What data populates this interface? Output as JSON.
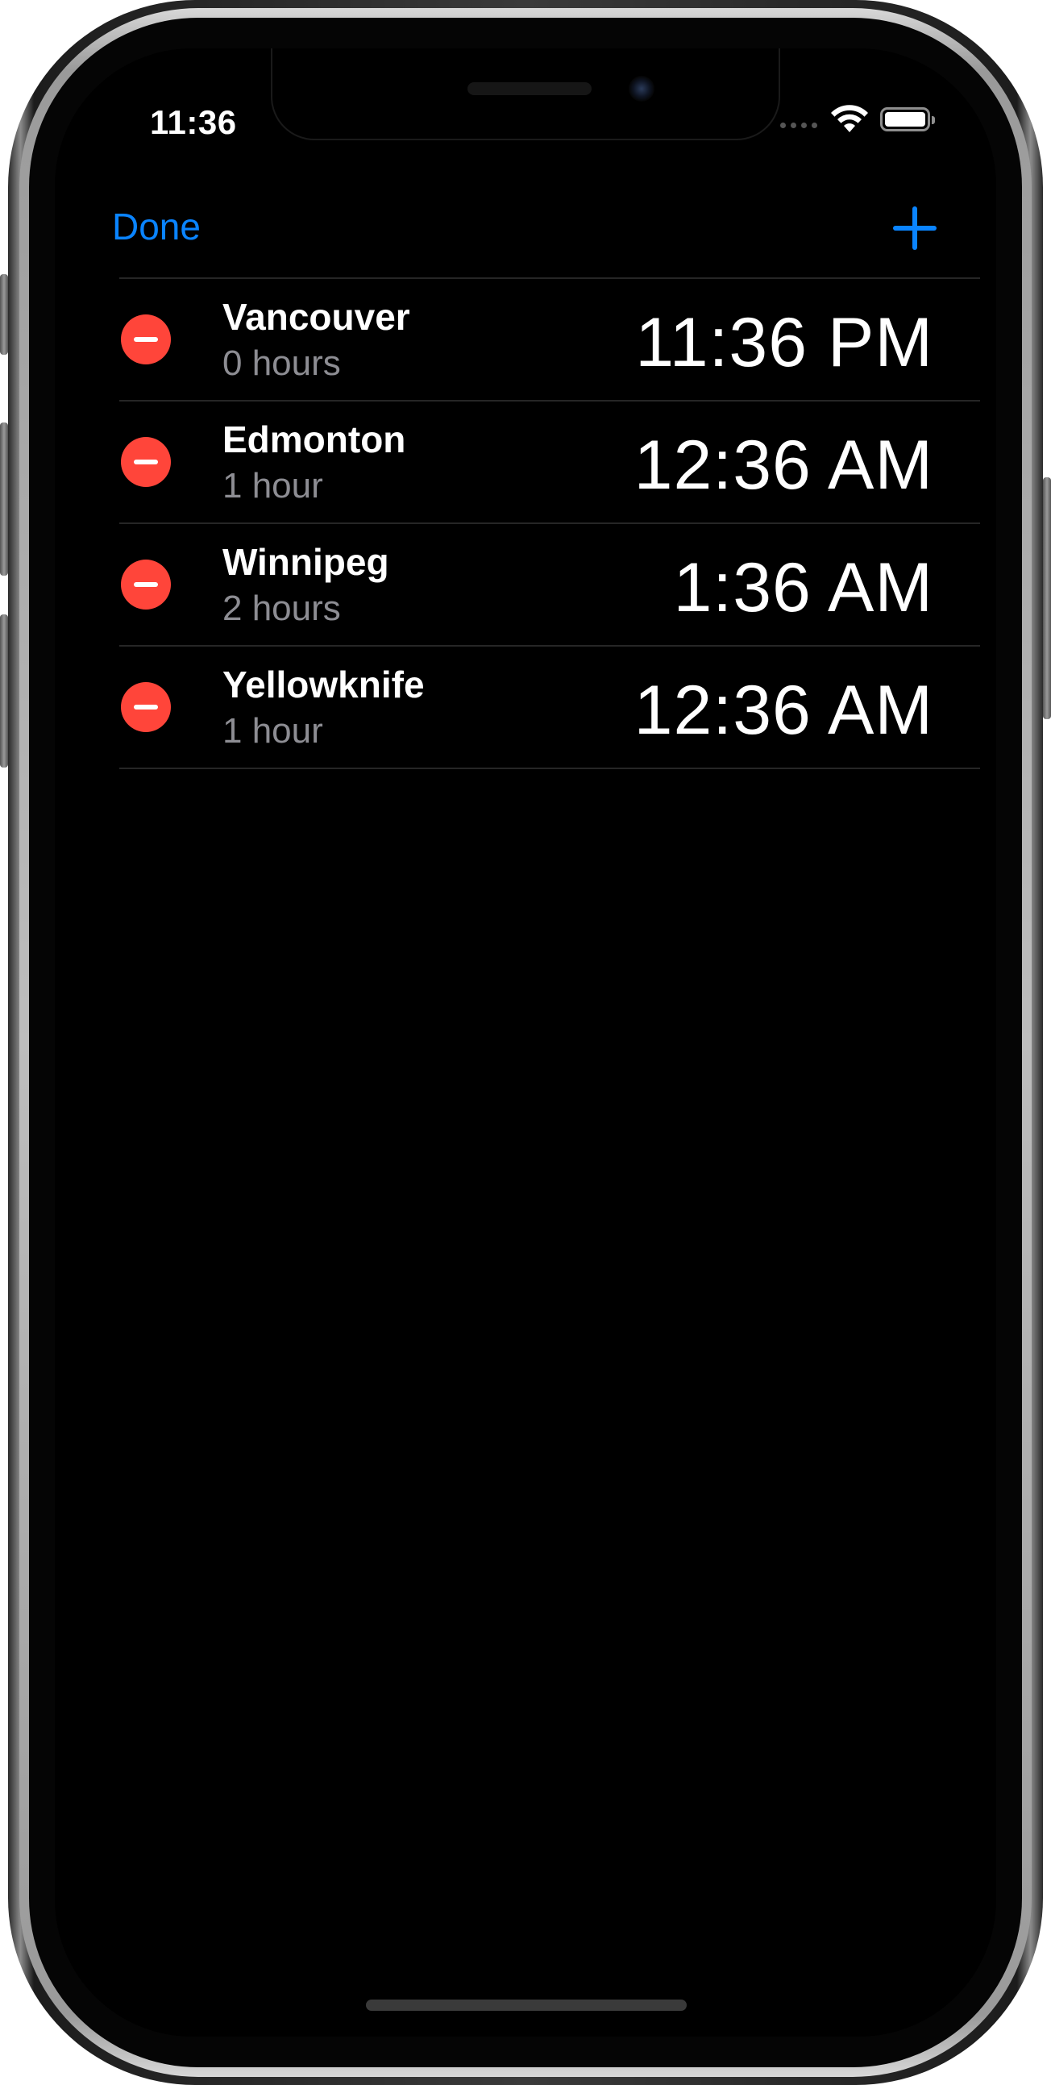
{
  "status_bar": {
    "time": "11:36"
  },
  "nav": {
    "done_label": "Done",
    "add_icon": "plus-icon"
  },
  "clocks": [
    {
      "city": "Vancouver",
      "offset": "0 hours",
      "time": "11:36 PM"
    },
    {
      "city": "Edmonton",
      "offset": "1 hour",
      "time": "12:36 AM"
    },
    {
      "city": "Winnipeg",
      "offset": "2 hours",
      "time": "1:36 AM"
    },
    {
      "city": "Yellowknife",
      "offset": "1 hour",
      "time": "12:36 AM"
    }
  ],
  "colors": {
    "accent": "#0a84ff",
    "delete": "#ff453a",
    "background": "#000000",
    "secondary_text": "#8d8d93"
  }
}
